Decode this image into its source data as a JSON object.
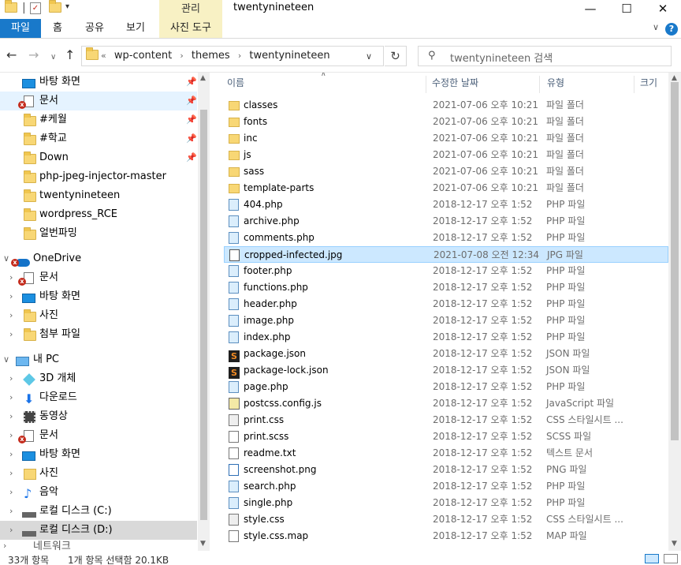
{
  "window": {
    "title": "twentynineteen",
    "context_tab_group": "관리",
    "minimize": "—",
    "maximize": "☐",
    "close": "✕"
  },
  "ribbon": {
    "tabs": [
      "파일",
      "홈",
      "공유",
      "보기"
    ],
    "context_tab": "사진 도구",
    "help": "?"
  },
  "address": {
    "prefix": "«",
    "crumbs": [
      "wp-content",
      "themes",
      "twentynineteen"
    ]
  },
  "search": {
    "placeholder": "twentynineteen 검색"
  },
  "nav": {
    "quick_access": [
      {
        "label": "바탕 화면",
        "icon": "desktop-icon",
        "pinned": true
      },
      {
        "label": "문서",
        "icon": "documents-icon",
        "pinned": true,
        "error": true,
        "selected": true
      },
      {
        "label": "#케월",
        "icon": "folder-icon",
        "pinned": true
      },
      {
        "label": "#학교",
        "icon": "folder-icon",
        "pinned": true
      },
      {
        "label": "Down",
        "icon": "folder-icon",
        "pinned": true
      },
      {
        "label": "php-jpeg-injector-master",
        "icon": "folder-icon"
      },
      {
        "label": "twentynineteen",
        "icon": "folder-icon"
      },
      {
        "label": "wordpress_RCE",
        "icon": "folder-icon"
      },
      {
        "label": "얼번파밍",
        "icon": "folder-icon"
      }
    ],
    "onedrive": {
      "label": "OneDrive",
      "children": [
        "문서",
        "바탕 화면",
        "사진",
        "첨부 파일"
      ]
    },
    "this_pc": {
      "label": "내 PC",
      "children": [
        "3D 개체",
        "다운로드",
        "동영상",
        "문서",
        "바탕 화면",
        "사진",
        "음악",
        "로컬 디스크 (C:)",
        "로컬 디스크 (D:)"
      ]
    },
    "network": "네트워크"
  },
  "columns": {
    "name": "이름",
    "date": "수정한 날짜",
    "type": "유형",
    "size": "크기"
  },
  "files": [
    {
      "name": "classes",
      "date": "2021-07-06 오후 10:21",
      "type": "파일 폴더",
      "icon": "folder"
    },
    {
      "name": "fonts",
      "date": "2021-07-06 오후 10:21",
      "type": "파일 폴더",
      "icon": "folder"
    },
    {
      "name": "inc",
      "date": "2021-07-06 오후 10:21",
      "type": "파일 폴더",
      "icon": "folder"
    },
    {
      "name": "js",
      "date": "2021-07-06 오후 10:21",
      "type": "파일 폴더",
      "icon": "folder"
    },
    {
      "name": "sass",
      "date": "2021-07-06 오후 10:21",
      "type": "파일 폴더",
      "icon": "folder"
    },
    {
      "name": "template-parts",
      "date": "2021-07-06 오후 10:21",
      "type": "파일 폴더",
      "icon": "folder"
    },
    {
      "name": "404.php",
      "date": "2018-12-17 오후 1:52",
      "type": "PHP 파일",
      "icon": "php"
    },
    {
      "name": "archive.php",
      "date": "2018-12-17 오후 1:52",
      "type": "PHP 파일",
      "icon": "php"
    },
    {
      "name": "comments.php",
      "date": "2018-12-17 오후 1:52",
      "type": "PHP 파일",
      "icon": "php"
    },
    {
      "name": "cropped-infected.jpg",
      "date": "2021-07-08 오전 12:34",
      "type": "JPG 파일",
      "icon": "img",
      "selected": true
    },
    {
      "name": "footer.php",
      "date": "2018-12-17 오후 1:52",
      "type": "PHP 파일",
      "icon": "php"
    },
    {
      "name": "functions.php",
      "date": "2018-12-17 오후 1:52",
      "type": "PHP 파일",
      "icon": "php"
    },
    {
      "name": "header.php",
      "date": "2018-12-17 오후 1:52",
      "type": "PHP 파일",
      "icon": "php"
    },
    {
      "name": "image.php",
      "date": "2018-12-17 오후 1:52",
      "type": "PHP 파일",
      "icon": "php"
    },
    {
      "name": "index.php",
      "date": "2018-12-17 오후 1:52",
      "type": "PHP 파일",
      "icon": "php"
    },
    {
      "name": "package.json",
      "date": "2018-12-17 오후 1:52",
      "type": "JSON 파일",
      "icon": "json"
    },
    {
      "name": "package-lock.json",
      "date": "2018-12-17 오후 1:52",
      "type": "JSON 파일",
      "icon": "json"
    },
    {
      "name": "page.php",
      "date": "2018-12-17 오후 1:52",
      "type": "PHP 파일",
      "icon": "php"
    },
    {
      "name": "postcss.config.js",
      "date": "2018-12-17 오후 1:52",
      "type": "JavaScript 파일",
      "icon": "js"
    },
    {
      "name": "print.css",
      "date": "2018-12-17 오후 1:52",
      "type": "CSS 스타일시트 ...",
      "icon": "css"
    },
    {
      "name": "print.scss",
      "date": "2018-12-17 오후 1:52",
      "type": "SCSS 파일",
      "icon": "txt"
    },
    {
      "name": "readme.txt",
      "date": "2018-12-17 오후 1:52",
      "type": "텍스트 문서",
      "icon": "txt"
    },
    {
      "name": "screenshot.png",
      "date": "2018-12-17 오후 1:52",
      "type": "PNG 파일",
      "icon": "png"
    },
    {
      "name": "search.php",
      "date": "2018-12-17 오후 1:52",
      "type": "PHP 파일",
      "icon": "php"
    },
    {
      "name": "single.php",
      "date": "2018-12-17 오후 1:52",
      "type": "PHP 파일",
      "icon": "php"
    },
    {
      "name": "style.css",
      "date": "2018-12-17 오후 1:52",
      "type": "CSS 스타일시트 ...",
      "icon": "css"
    },
    {
      "name": "style.css.map",
      "date": "2018-12-17 오후 1:52",
      "type": "MAP 파일",
      "icon": "txt"
    }
  ],
  "status": {
    "count": "33개 항목",
    "selection": "1개 항목 선택함 20.1KB"
  }
}
